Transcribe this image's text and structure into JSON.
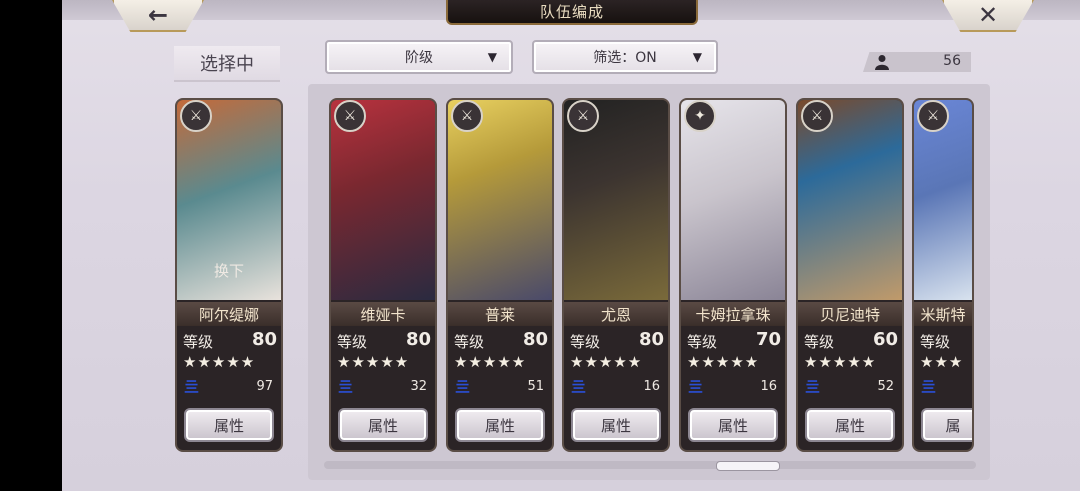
{
  "header": {
    "title": "队伍编成",
    "back_icon": "←",
    "close_icon": "✕"
  },
  "left_panel": {
    "selecting_label": "选择中"
  },
  "filters": {
    "rank_label": "阶级",
    "filter_label": "筛选：ON",
    "arrow": "▼"
  },
  "unit_count": "56",
  "selected_card": {
    "name": "阿尔缇娜",
    "swap_label": "换下",
    "level_label": "等级",
    "level": "80",
    "stars": "★★★★★",
    "rank_glyph": "亖",
    "number": "97",
    "attr_label": "属性",
    "badge": "⚔"
  },
  "roster": [
    {
      "name": "维娅卡",
      "level_label": "等级",
      "level": "80",
      "stars": "★★★★★",
      "rank_glyph": "亖",
      "number": "32",
      "attr_label": "属性",
      "badge": "⚔"
    },
    {
      "name": "普莱",
      "level_label": "等级",
      "level": "80",
      "stars": "★★★★★",
      "rank_glyph": "亖",
      "number": "51",
      "attr_label": "属性",
      "badge": "⚔"
    },
    {
      "name": "尤恩",
      "level_label": "等级",
      "level": "80",
      "stars": "★★★★★",
      "rank_glyph": "亖",
      "number": "16",
      "attr_label": "属性",
      "badge": "⚔"
    },
    {
      "name": "卡姆拉拿珠",
      "level_label": "等级",
      "level": "70",
      "stars": "★★★★★",
      "rank_glyph": "亖",
      "number": "16",
      "attr_label": "属性",
      "badge": "✦"
    },
    {
      "name": "贝尼迪特",
      "level_label": "等级",
      "level": "60",
      "stars": "★★★★★",
      "rank_glyph": "亖",
      "number": "52",
      "attr_label": "属性",
      "badge": "⚔"
    },
    {
      "name": "米斯特",
      "level_label": "等级",
      "level": "",
      "stars": "★★★",
      "rank_glyph": "亖",
      "number": "",
      "attr_label": "属",
      "badge": "⚔"
    }
  ],
  "colors": {
    "portrait_0": "#5a8a8f",
    "portrait_1": "#7a2830",
    "portrait_2": "#b59a3a",
    "portrait_3": "#3c3430",
    "portrait_4": "#c9c4cc",
    "portrait_5": "#7a4a2c",
    "portrait_6": "#5a76b6"
  }
}
